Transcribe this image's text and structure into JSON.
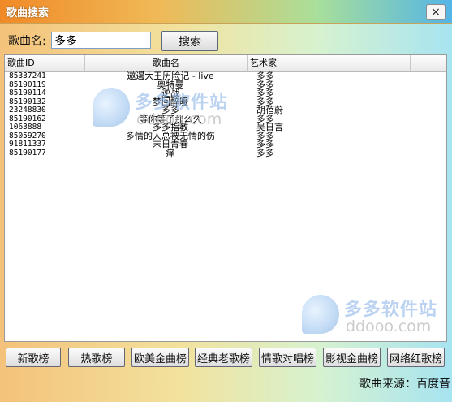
{
  "window": {
    "title": "歌曲搜索",
    "close_glyph": "×"
  },
  "search": {
    "label": "歌曲名:",
    "value": "多多",
    "button_label": "搜索"
  },
  "list": {
    "columns": [
      "歌曲ID",
      "歌曲名",
      "艺术家"
    ],
    "rows": [
      {
        "id": "85337241",
        "name": "遨遏大王历险记 - live",
        "artist": "多多"
      },
      {
        "id": "85190119",
        "name": "奥特曼",
        "artist": "多多"
      },
      {
        "id": "85190114",
        "name": "逆战",
        "artist": "多多"
      },
      {
        "id": "85190132",
        "name": "梦回醉暖",
        "artist": "多多"
      },
      {
        "id": "23248830",
        "name": "多多",
        "artist": "胡蓓蔚"
      },
      {
        "id": "85190162",
        "name": "等你等了那么久",
        "artist": "多多"
      },
      {
        "id": "1063888",
        "name": "多多指教",
        "artist": "吴日言"
      },
      {
        "id": "85059270",
        "name": "多情的人总被无情的伤",
        "artist": "多多"
      },
      {
        "id": "91811337",
        "name": "末日青春",
        "artist": "多多"
      },
      {
        "id": "85190177",
        "name": "痒",
        "artist": "多多"
      }
    ]
  },
  "watermark": {
    "cn": "多多软件站",
    "en": "ddooo.com"
  },
  "nav_buttons": [
    "新歌榜",
    "热歌榜",
    "欧美金曲榜",
    "经典老歌榜",
    "情歌对唱榜",
    "影视金曲榜",
    "网络红歌榜"
  ],
  "footer": {
    "source": "歌曲来源：百度音"
  }
}
